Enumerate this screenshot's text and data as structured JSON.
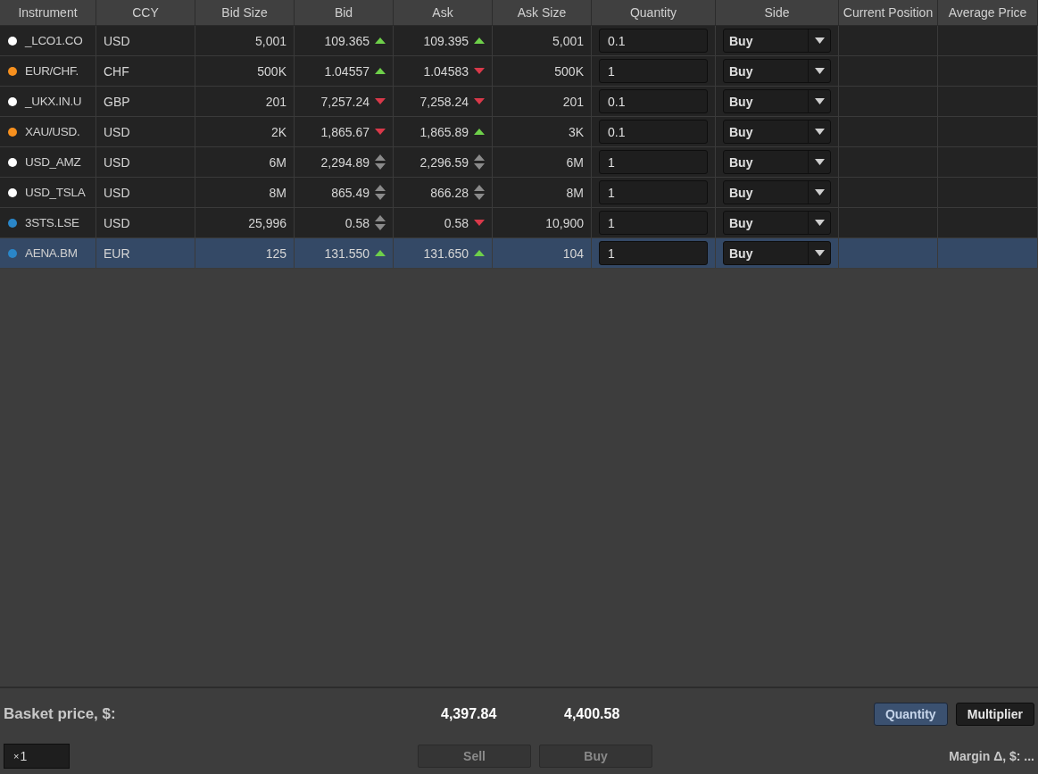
{
  "table": {
    "columns": [
      "Instrument",
      "CCY",
      "Bid Size",
      "Bid",
      "Ask",
      "Ask Size",
      "Quantity",
      "Side",
      "Current Position",
      "Average Price"
    ],
    "rows": [
      {
        "instrument": "_LCO1.CO",
        "color": "#ffffff",
        "ccy": "USD",
        "bid_size": "5,001",
        "bid": {
          "value": "109.365",
          "kind": "up"
        },
        "ask": {
          "value": "109.395",
          "kind": "up"
        },
        "ask_size": "5,001",
        "quantity": "0.1",
        "side": "Buy",
        "selected": false
      },
      {
        "instrument": "EUR/CHF.",
        "color": "#f7901e",
        "ccy": "CHF",
        "bid_size": "500K",
        "bid": {
          "value": "1.04557",
          "kind": "up"
        },
        "ask": {
          "value": "1.04583",
          "kind": "down"
        },
        "ask_size": "500K",
        "quantity": "1",
        "side": "Buy",
        "selected": false
      },
      {
        "instrument": "_UKX.IN.U",
        "color": "#ffffff",
        "ccy": "GBP",
        "bid_size": "201",
        "bid": {
          "value": "7,257.24",
          "kind": "down"
        },
        "ask": {
          "value": "7,258.24",
          "kind": "down"
        },
        "ask_size": "201",
        "quantity": "0.1",
        "side": "Buy",
        "selected": false
      },
      {
        "instrument": "XAU/USD.",
        "color": "#f7901e",
        "ccy": "USD",
        "bid_size": "2K",
        "bid": {
          "value": "1,865.67",
          "kind": "down"
        },
        "ask": {
          "value": "1,865.89",
          "kind": "up"
        },
        "ask_size": "3K",
        "quantity": "0.1",
        "side": "Buy",
        "selected": false
      },
      {
        "instrument": "USD_AMZ",
        "color": "#ffffff",
        "ccy": "USD",
        "bid_size": "6M",
        "bid": {
          "value": "2,294.89",
          "kind": "flat"
        },
        "ask": {
          "value": "2,296.59",
          "kind": "flat"
        },
        "ask_size": "6M",
        "quantity": "1",
        "side": "Buy",
        "selected": false
      },
      {
        "instrument": "USD_TSLA",
        "color": "#ffffff",
        "ccy": "USD",
        "bid_size": "8M",
        "bid": {
          "value": "865.49",
          "kind": "flat"
        },
        "ask": {
          "value": "866.28",
          "kind": "flat"
        },
        "ask_size": "8M",
        "quantity": "1",
        "side": "Buy",
        "selected": false
      },
      {
        "instrument": "3STS.LSE",
        "color": "#2a86c8",
        "ccy": "USD",
        "bid_size": "25,996",
        "bid": {
          "value": "0.58",
          "kind": "flat"
        },
        "ask": {
          "value": "0.58",
          "kind": "down"
        },
        "ask_size": "10,900",
        "quantity": "1",
        "side": "Buy",
        "selected": false
      },
      {
        "instrument": "AENA.BM",
        "color": "#2a86c8",
        "ccy": "EUR",
        "bid_size": "125",
        "bid": {
          "value": "131.550",
          "kind": "up"
        },
        "ask": {
          "value": "131.650",
          "kind": "up"
        },
        "ask_size": "104",
        "quantity": "1",
        "side": "Buy",
        "selected": true
      }
    ]
  },
  "footer": {
    "basket_label": "Basket price, $:",
    "basket_bid": "4,397.84",
    "basket_ask": "4,400.58",
    "modes": [
      {
        "label": "Quantity",
        "selected": true
      },
      {
        "label": "Multiplier",
        "selected": false
      }
    ],
    "multiplier_prefix": "×",
    "multiplier_value": "1",
    "sell": {
      "label": "Sell",
      "disabled": true
    },
    "buy": {
      "label": "Buy",
      "disabled": true
    },
    "margin": "Margin Δ, $: ..."
  }
}
